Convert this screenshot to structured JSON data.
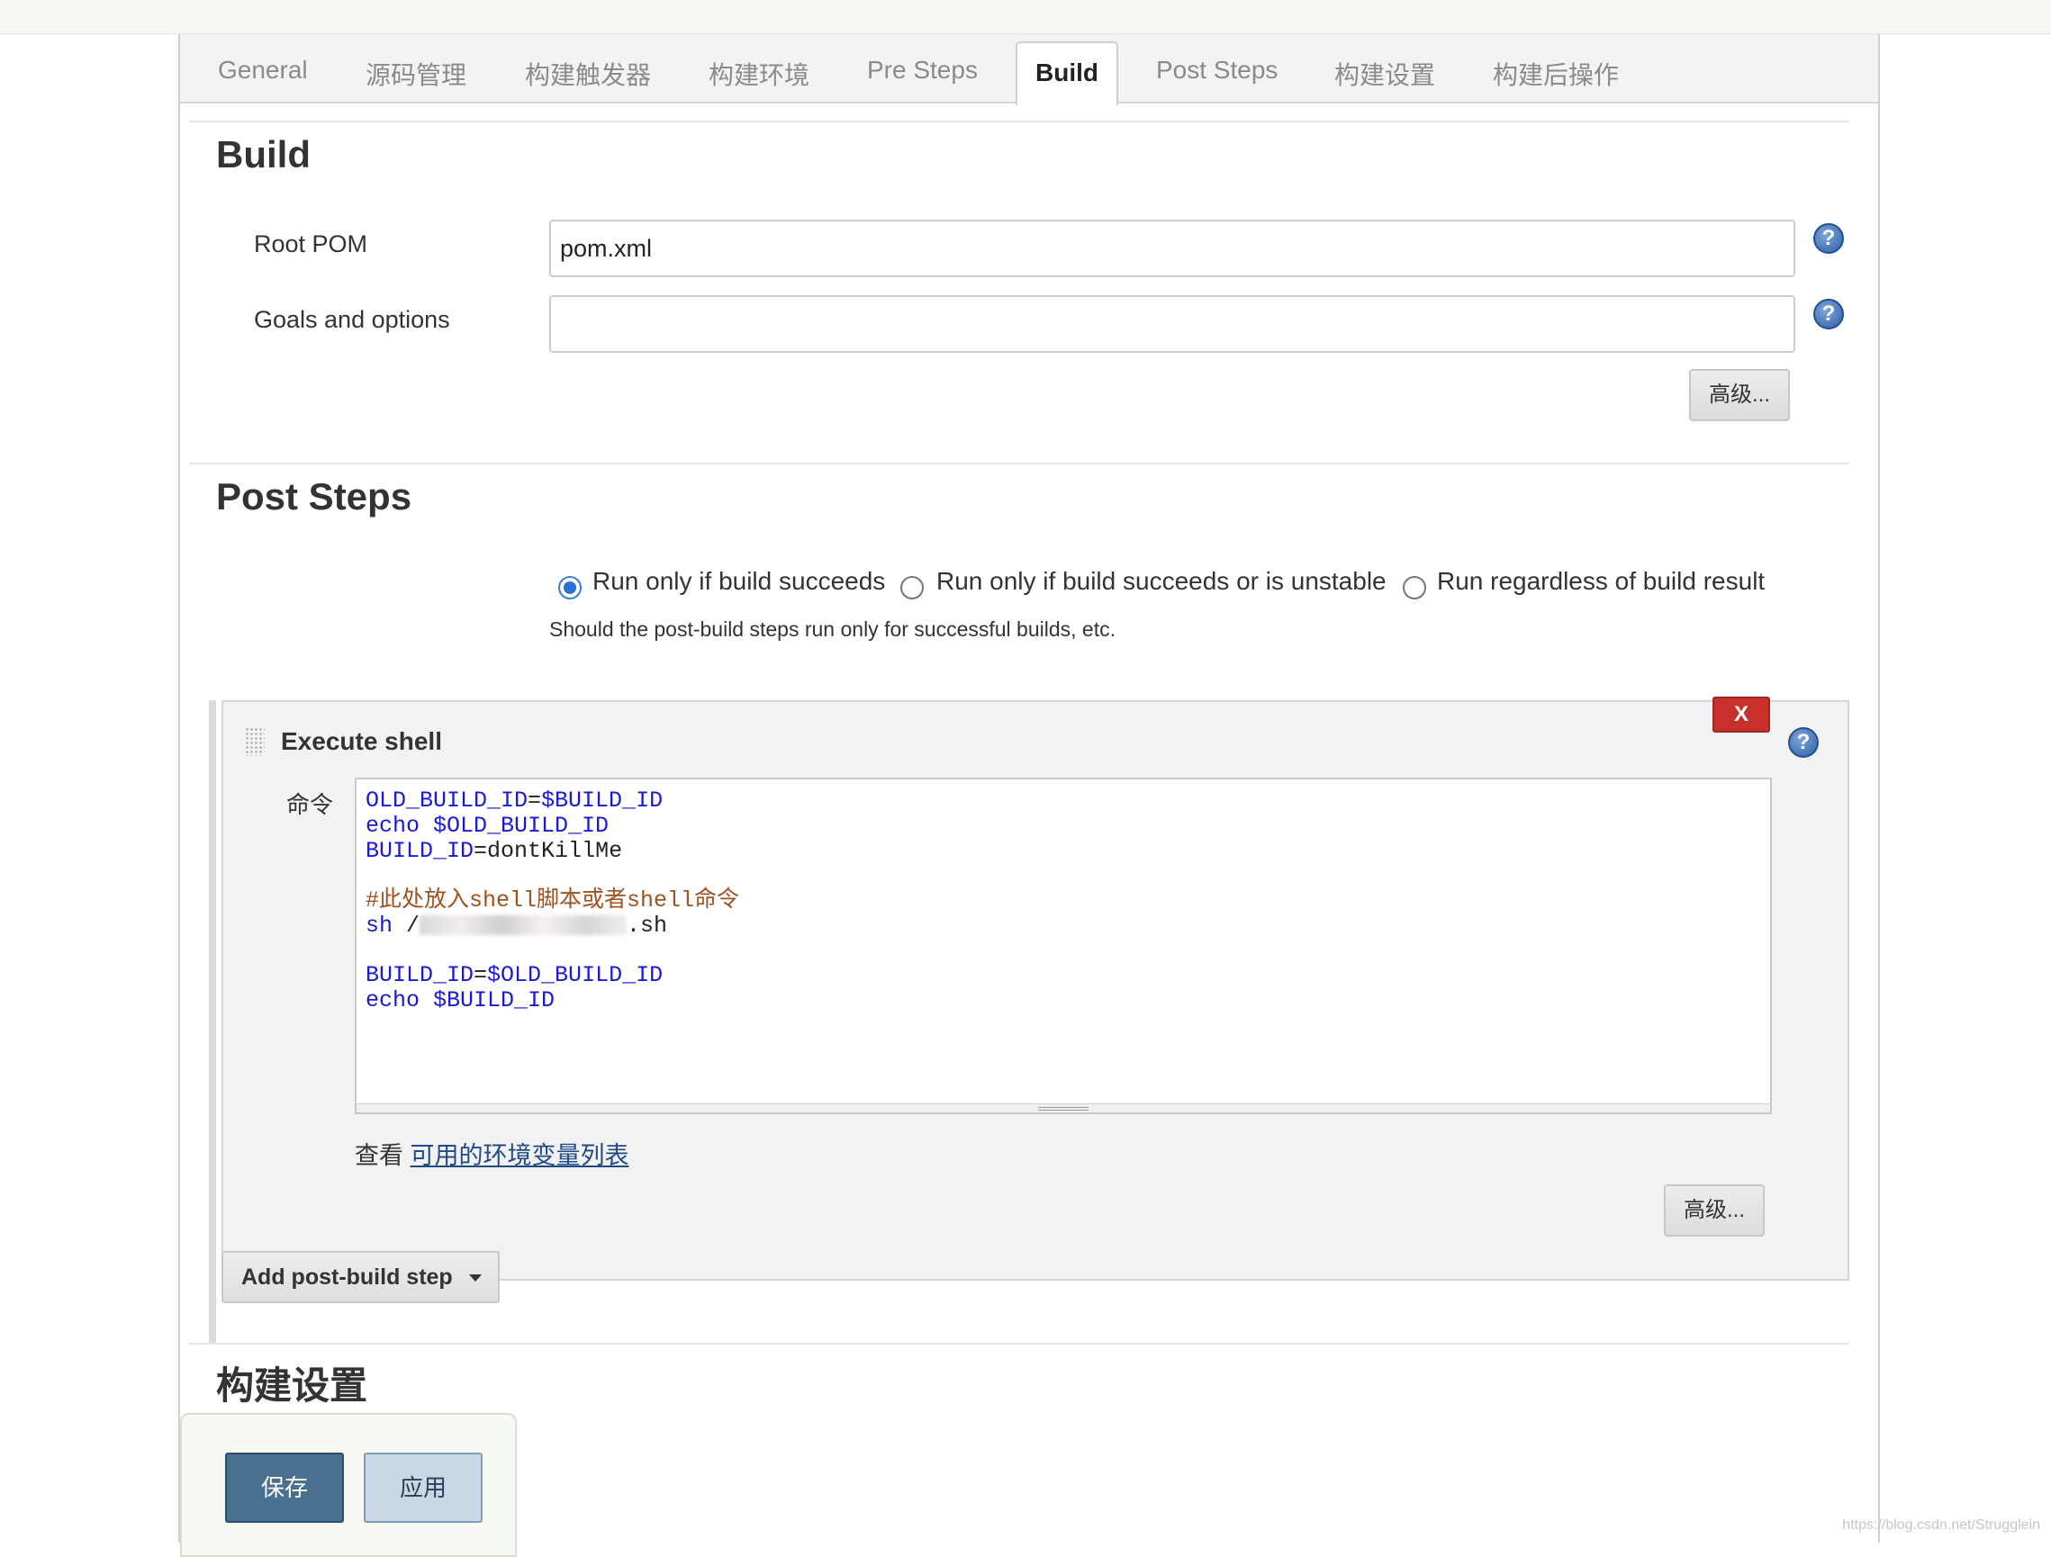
{
  "tabs": [
    {
      "label": "General"
    },
    {
      "label": "源码管理"
    },
    {
      "label": "构建触发器"
    },
    {
      "label": "构建环境"
    },
    {
      "label": "Pre Steps"
    },
    {
      "label": "Build",
      "active": true
    },
    {
      "label": "Post Steps"
    },
    {
      "label": "构建设置"
    },
    {
      "label": "构建后操作"
    }
  ],
  "build": {
    "title": "Build",
    "root_pom_label": "Root POM",
    "root_pom_value": "pom.xml",
    "goals_label": "Goals and options",
    "goals_value": "",
    "advanced_label": "高级..."
  },
  "post_steps": {
    "title": "Post Steps",
    "radio_options": [
      {
        "label": "Run only if build succeeds",
        "checked": true
      },
      {
        "label": "Run only if build succeeds or is unstable",
        "checked": false
      },
      {
        "label": "Run regardless of build result",
        "checked": false
      }
    ],
    "description": "Should the post-build steps run only for successful builds, etc.",
    "execute_shell": {
      "title": "Execute shell",
      "delete_label": "X",
      "command_label": "命令",
      "code": {
        "l1_var": "OLD_BUILD_ID",
        "l1_eq": "=",
        "l1_val": "$BUILD_ID",
        "l2_cmd": "echo",
        "l2_arg": "$OLD_BUILD_ID",
        "l3_var": "BUILD_ID",
        "l3_eq": "=",
        "l3_val": "dontKillMe",
        "l5_comment": "#此处放入shell脚本或者shell命令",
        "l6_cmd": "sh",
        "l6_prefix": "/",
        "l6_suffix": ".sh",
        "l8_var": "BUILD_ID",
        "l8_eq": "=",
        "l8_val": "$OLD_BUILD_ID",
        "l9_cmd": "echo",
        "l9_arg": "$BUILD_ID"
      },
      "env_prefix": "查看",
      "env_link": "可用的环境变量列表",
      "advanced_label": "高级..."
    },
    "add_step_label": "Add post-build step"
  },
  "build_settings": {
    "title": "构建设置"
  },
  "footer": {
    "save_label": "保存",
    "apply_label": "应用"
  },
  "watermark": "https://blog.csdn.net/Strugglein"
}
